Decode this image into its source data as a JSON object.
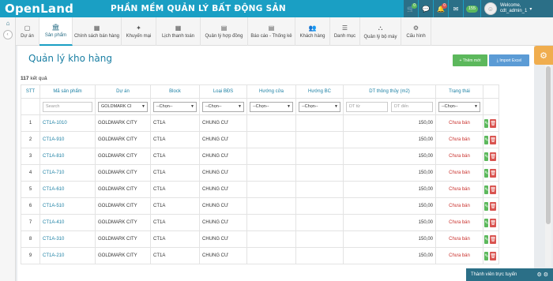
{
  "topbar": {
    "logo": "OpenLand",
    "title": "PHẦN MỀM QUẢN LÝ BẤT ĐỘNG SẢN",
    "buttons": [
      {
        "icon": "cart-icon",
        "glyph": "🛒",
        "badge": "0",
        "badge_color": "#5cb85c"
      },
      {
        "icon": "chat-icon",
        "glyph": "💬",
        "badge": "",
        "badge_color": ""
      },
      {
        "icon": "bell-icon",
        "glyph": "🔔",
        "badge": "0",
        "badge_color": "#d9534f"
      },
      {
        "icon": "mail-icon",
        "glyph": "✉",
        "badge": "",
        "badge_color": ""
      }
    ],
    "counter_badge": "155",
    "user": {
      "welcome": "Welcome,",
      "name": "cdt_admin_1"
    }
  },
  "tabs": [
    {
      "label": "Dự án",
      "icon": "document-icon",
      "glyph": "▢",
      "active": false,
      "width": 30
    },
    {
      "label": "Sản phẩm",
      "icon": "building-icon",
      "glyph": "🏛",
      "active": true,
      "width": 42
    },
    {
      "label": "Chính sách bán hàng",
      "icon": "calendar-icon",
      "glyph": "▦",
      "active": false,
      "width": 62
    },
    {
      "label": "Khuyến mại",
      "icon": "gift-icon",
      "glyph": "✦",
      "active": false,
      "width": 44
    },
    {
      "label": "Lịch thanh toán",
      "icon": "calendar-icon",
      "glyph": "▦",
      "active": false,
      "width": 56
    },
    {
      "label": "Quản lý hợp đồng",
      "icon": "document-icon",
      "glyph": "▤",
      "active": false,
      "width": 60
    },
    {
      "label": "Báo cáo - Thống kê",
      "icon": "report-icon",
      "glyph": "▤",
      "active": false,
      "width": 60
    },
    {
      "label": "Khách hàng",
      "icon": "users-icon",
      "glyph": "👥",
      "active": false,
      "width": 44
    },
    {
      "label": "Danh mục",
      "icon": "list-icon",
      "glyph": "☰",
      "active": false,
      "width": 38
    },
    {
      "label": "Quản lý bộ máy",
      "icon": "org-icon",
      "glyph": "⛬",
      "active": false,
      "width": 52
    },
    {
      "label": "Cấu hình",
      "icon": "gears-icon",
      "glyph": "⚙",
      "active": false,
      "width": 38
    }
  ],
  "page": {
    "title": "Quản lý kho hàng",
    "add_label": "+ Thêm mới",
    "import_label": "⤓ Import Excel",
    "count": "117",
    "count_suffix": "kết quả"
  },
  "table": {
    "columns": [
      "STT",
      "Mã sản phẩm",
      "Dự án",
      "Block",
      "Loại BĐS",
      "Hướng cửa",
      "Hướng BC",
      "DT thông thủy (m2)",
      "Trạng thái",
      ""
    ],
    "filters": {
      "search_placeholder": "Search",
      "project": "GOLDMARK CI",
      "choose": "--Chọn--",
      "dt_from": "DT từ",
      "dt_to": "DT đến"
    },
    "rows": [
      {
        "stt": "1",
        "code": "CT1A-1010",
        "project": "GOLDMARK CITY",
        "block": "CT1A",
        "type": "CHUNG CƯ",
        "door": "",
        "balcony": "",
        "area": "150,00",
        "status": "Chưa bán"
      },
      {
        "stt": "2",
        "code": "CT1A-910",
        "project": "GOLDMARK CITY",
        "block": "CT1A",
        "type": "CHUNG CƯ",
        "door": "",
        "balcony": "",
        "area": "150,00",
        "status": "Chưa bán"
      },
      {
        "stt": "3",
        "code": "CT1A-810",
        "project": "GOLDMARK CITY",
        "block": "CT1A",
        "type": "CHUNG CƯ",
        "door": "",
        "balcony": "",
        "area": "150,00",
        "status": "Chưa bán"
      },
      {
        "stt": "4",
        "code": "CT1A-710",
        "project": "GOLDMARK CITY",
        "block": "CT1A",
        "type": "CHUNG CƯ",
        "door": "",
        "balcony": "",
        "area": "150,00",
        "status": "Chưa bán"
      },
      {
        "stt": "5",
        "code": "CT1A-610",
        "project": "GOLDMARK CITY",
        "block": "CT1A",
        "type": "CHUNG CƯ",
        "door": "",
        "balcony": "",
        "area": "150,00",
        "status": "Chưa bán"
      },
      {
        "stt": "6",
        "code": "CT1A-510",
        "project": "GOLDMARK CITY",
        "block": "CT1A",
        "type": "CHUNG CƯ",
        "door": "",
        "balcony": "",
        "area": "150,00",
        "status": "Chưa bán"
      },
      {
        "stt": "7",
        "code": "CT1A-410",
        "project": "GOLDMARK CITY",
        "block": "CT1A",
        "type": "CHUNG CƯ",
        "door": "",
        "balcony": "",
        "area": "150,00",
        "status": "Chưa bán"
      },
      {
        "stt": "8",
        "code": "CT1A-310",
        "project": "GOLDMARK CITY",
        "block": "CT1A",
        "type": "CHUNG CƯ",
        "door": "",
        "balcony": "",
        "area": "150,00",
        "status": "Chưa bán"
      },
      {
        "stt": "9",
        "code": "CT1A-210",
        "project": "GOLDMARK CITY",
        "block": "CT1A",
        "type": "CHUNG CƯ",
        "door": "",
        "balcony": "",
        "area": "150,00",
        "status": "Chưa bán"
      }
    ]
  },
  "online": {
    "label": "Thành viên trực tuyến"
  }
}
